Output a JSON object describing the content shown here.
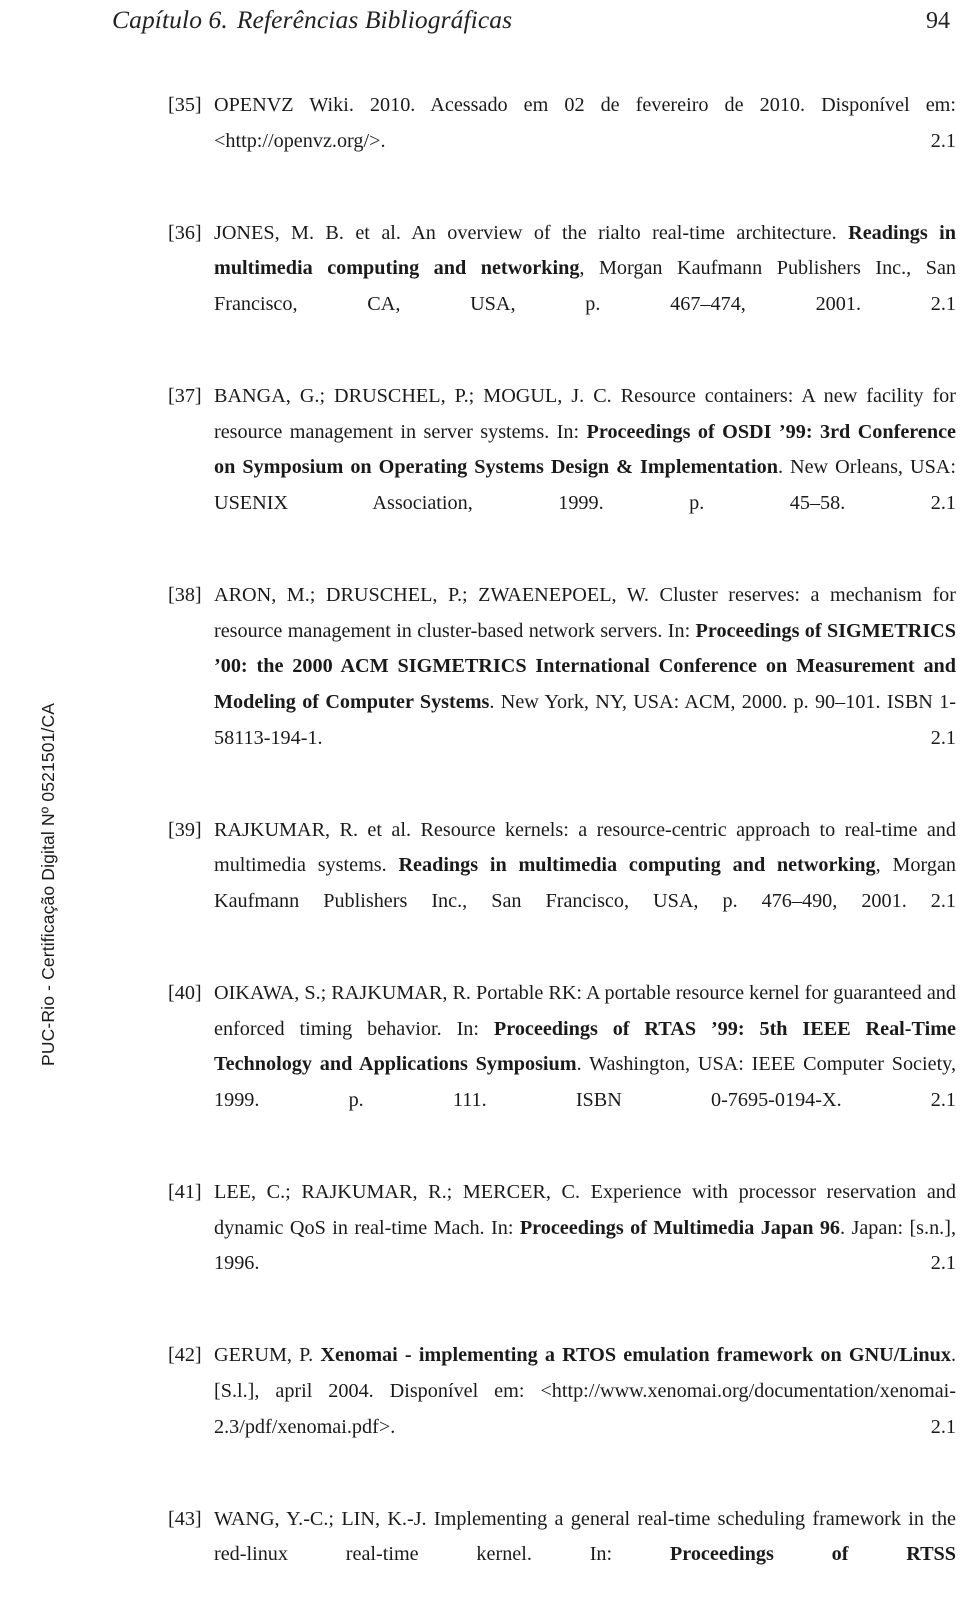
{
  "header": {
    "chapter": "Capítulo 6.",
    "title": "Referências Bibliográficas",
    "page_number": "94"
  },
  "side_stamp": {
    "text": "PUC-Rio - Certificação Digital Nº 0521501/CA"
  },
  "bibliography": {
    "entries": [
      {
        "label": "[35]",
        "parts": [
          {
            "text": "OPENVZ Wiki. 2010. Acessado em 02 de fevereiro de 2010. Disponível em: <http://openvz.org/>. 2.1",
            "bold": false
          }
        ]
      },
      {
        "label": "[36]",
        "parts": [
          {
            "text": "JONES, M. B. et al. An overview of the rialto real-time architecture. ",
            "bold": false
          },
          {
            "text": "Readings in multimedia computing and networking",
            "bold": true
          },
          {
            "text": ", Morgan Kaufmann Publishers Inc., San Francisco, CA, USA, p. 467–474, 2001. 2.1",
            "bold": false
          }
        ]
      },
      {
        "label": "[37]",
        "parts": [
          {
            "text": "BANGA, G.; DRUSCHEL, P.; MOGUL, J. C. Resource containers: A new facility for resource management in server systems. In: ",
            "bold": false
          },
          {
            "text": "Proceedings of OSDI ’99: 3rd Conference on Symposium on Operating Systems Design & Implementation",
            "bold": true
          },
          {
            "text": ". New Orleans, USA: USENIX Association, 1999. p. 45–58. 2.1",
            "bold": false
          }
        ]
      },
      {
        "label": "[38]",
        "parts": [
          {
            "text": "ARON, M.; DRUSCHEL, P.; ZWAENEPOEL, W. Cluster reserves: a mechanism for resource management in cluster-based network servers. In: ",
            "bold": false
          },
          {
            "text": "Proceedings of SIGMETRICS ’00: the 2000 ACM SIGMETRICS International Conference on Measurement and Modeling of Computer Systems",
            "bold": true
          },
          {
            "text": ". New York, NY, USA: ACM, 2000. p. 90–101. ISBN 1-58113-194-1. 2.1",
            "bold": false
          }
        ]
      },
      {
        "label": "[39]",
        "parts": [
          {
            "text": "RAJKUMAR, R. et al. Resource kernels: a resource-centric approach to real-time and multimedia systems. ",
            "bold": false
          },
          {
            "text": "Readings in multimedia computing and networking",
            "bold": true
          },
          {
            "text": ", Morgan Kaufmann Publishers Inc., San Francisco, USA, p. 476–490, 2001. 2.1",
            "bold": false
          }
        ]
      },
      {
        "label": "[40]",
        "parts": [
          {
            "text": "OIKAWA, S.; RAJKUMAR, R. Portable RK: A portable resource kernel for guaranteed and enforced timing behavior. In: ",
            "bold": false
          },
          {
            "text": "Proceedings of RTAS ’99: 5th IEEE Real-Time Technology and Applications Symposium",
            "bold": true
          },
          {
            "text": ". Washington, USA: IEEE Computer Society, 1999. p. 111. ISBN 0-7695-0194-X. 2.1",
            "bold": false
          }
        ]
      },
      {
        "label": "[41]",
        "parts": [
          {
            "text": "LEE, C.; RAJKUMAR, R.; MERCER, C. Experience with processor reservation and dynamic QoS in real-time Mach. In: ",
            "bold": false
          },
          {
            "text": "Proceedings of Multimedia Japan 96",
            "bold": true
          },
          {
            "text": ". Japan: [s.n.], 1996. 2.1",
            "bold": false
          }
        ]
      },
      {
        "label": "[42]",
        "parts": [
          {
            "text": "GERUM, P. ",
            "bold": false
          },
          {
            "text": "Xenomai - implementing a RTOS emulation framework on GNU/Linux",
            "bold": true
          },
          {
            "text": ". [S.l.], april 2004. Disponível em: <http://www.xenomai.org/documentation/xenomai-2.3/pdf/xenomai.pdf>. 2.1",
            "bold": false
          }
        ]
      },
      {
        "label": "[43]",
        "parts": [
          {
            "text": "WANG, Y.-C.; LIN, K.-J. Implementing a general real-time scheduling framework in the red-linux real-time kernel. In: ",
            "bold": false
          },
          {
            "text": "Proceedings of RTSS",
            "bold": true
          }
        ]
      }
    ]
  }
}
